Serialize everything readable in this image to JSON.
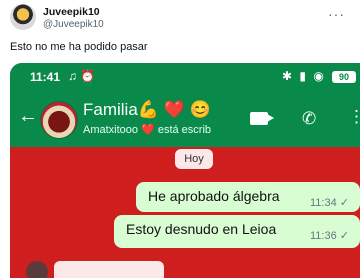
{
  "tweet": {
    "display_name": "Juveepik10",
    "handle": "@Juveepik10",
    "text": "Esto no me ha podido pasar",
    "menu": "···"
  },
  "phone": {
    "status_time": "11:41",
    "status_left_icons": "♫ ⏰",
    "status_right_icons": "✱ ▮ ◉",
    "battery": "90"
  },
  "chat": {
    "back": "←",
    "group_name": "Familia💪 ❤️ 😊",
    "subtitle": "Amatxitooo ❤️ está escrib",
    "call_glyph": "✆",
    "more_glyph": "⋮",
    "date_chip": "Hoy",
    "messages": [
      {
        "text": "He aprobado álgebra",
        "time": "11:34 ✓"
      },
      {
        "text": "Estoy desnudo en Leioa",
        "time": "11:36 ✓"
      }
    ]
  },
  "colors": {
    "accent_green": "#0a8a4a",
    "chat_background_red": "#cf1e1e",
    "outgoing_bubble": "#d9fdd3"
  }
}
